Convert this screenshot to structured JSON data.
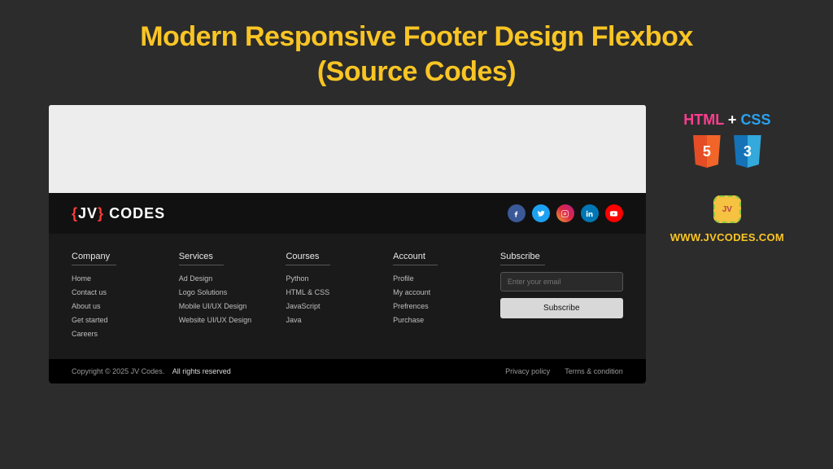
{
  "title_line1": "Modern Responsive Footer Design Flexbox",
  "title_line2": "(Source Codes)",
  "logo": {
    "brace_open": "{",
    "jv": "JV",
    "brace_close": "}",
    "codes": " CODES"
  },
  "socials": {
    "facebook": "facebook-icon",
    "twitter": "twitter-icon",
    "instagram": "instagram-icon",
    "linkedin": "linkedin-icon",
    "youtube": "youtube-icon"
  },
  "columns": {
    "company": {
      "heading": "Company",
      "items": [
        "Home",
        "Contact us",
        "About us",
        "Get started",
        "Careers"
      ]
    },
    "services": {
      "heading": "Services",
      "items": [
        "Ad Design",
        "Logo Solutions",
        "Mobile UI/UX Design",
        "Website UI/UX Design"
      ]
    },
    "courses": {
      "heading": "Courses",
      "items": [
        "Python",
        "HTML & CSS",
        "JavaScript",
        "Java"
      ]
    },
    "account": {
      "heading": "Account",
      "items": [
        "Profile",
        "My account",
        "Prefrences",
        "Purchase"
      ]
    },
    "subscribe": {
      "heading": "Subscribe",
      "placeholder": "Enter your email",
      "button": "Subscribe"
    }
  },
  "bottom": {
    "copyright_prefix": "Copyright © 2025 JV Codes.",
    "rights": "All rights reserved",
    "privacy": "Privacy policy",
    "terms": "Terms & condition"
  },
  "sidebar": {
    "html": "HTML",
    "plus": " + ",
    "css": "CSS",
    "badge_html": "5",
    "badge_css": "3",
    "jv_small": "JV",
    "url": "WWW.JVCODES.COM"
  }
}
